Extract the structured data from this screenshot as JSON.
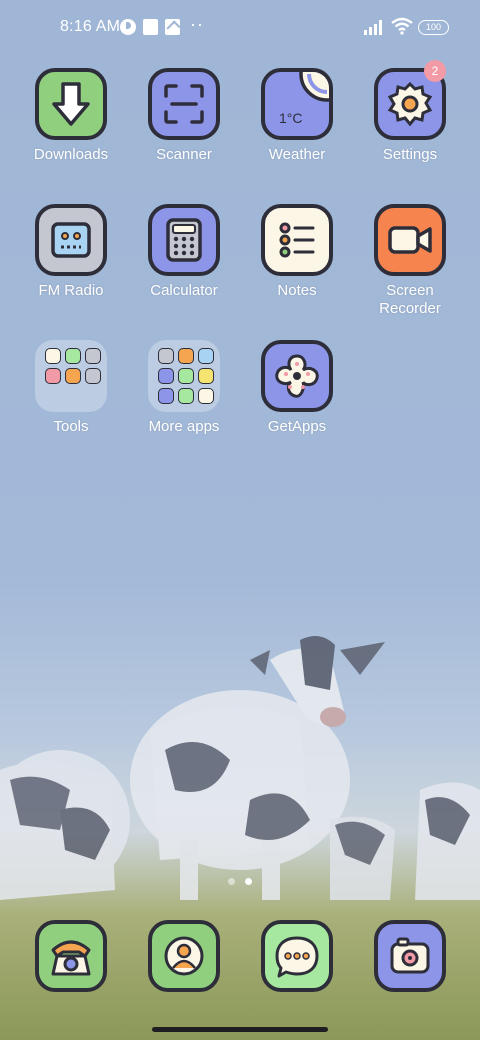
{
  "status_bar": {
    "time": "8:16 AM",
    "battery": "100",
    "dots": "··",
    "icons": [
      "circle-status-icon",
      "square-notification-icon",
      "box-notification-icon",
      "signal-icon",
      "wifi-icon",
      "battery-icon"
    ]
  },
  "apps": [
    {
      "label": "Downloads",
      "icon": "download-arrow-icon",
      "bg": "#8fcf7e"
    },
    {
      "label": "Scanner",
      "icon": "scan-frame-icon",
      "bg": "#8c95e8"
    },
    {
      "label": "Weather",
      "icon": "weather-icon",
      "bg": "#8c95e8",
      "temp": "1°C"
    },
    {
      "label": "Settings",
      "icon": "gear-icon",
      "bg": "#8c95e8",
      "badge": "2"
    },
    {
      "label": "FM Radio",
      "icon": "radio-icon",
      "bg": "#c4c7cf"
    },
    {
      "label": "Calculator",
      "icon": "calculator-icon",
      "bg": "#8c95e8"
    },
    {
      "label": "Notes",
      "icon": "notes-list-icon",
      "bg": "#fbf6e6"
    },
    {
      "label": "Screen Recorder",
      "icon": "video-camera-icon",
      "bg": "#f5844f"
    },
    {
      "label": "Tools",
      "icon": "folder-icon",
      "bg": "folder"
    },
    {
      "label": "More apps",
      "icon": "folder-icon",
      "bg": "folder"
    },
    {
      "label": "GetApps",
      "icon": "flower-icon",
      "bg": "#8c95e8"
    }
  ],
  "dock": [
    {
      "icon": "phone-icon",
      "bg": "#8fcf7e"
    },
    {
      "icon": "contacts-icon",
      "bg": "#8fcf7e"
    },
    {
      "icon": "messages-icon",
      "bg": "#a6e8a0"
    },
    {
      "icon": "camera-icon",
      "bg": "#8c95e8"
    }
  ],
  "colors": {
    "sky": "#9fb6d6",
    "icon_outline": "#2e2e3a",
    "badge": "#f29aa6"
  }
}
